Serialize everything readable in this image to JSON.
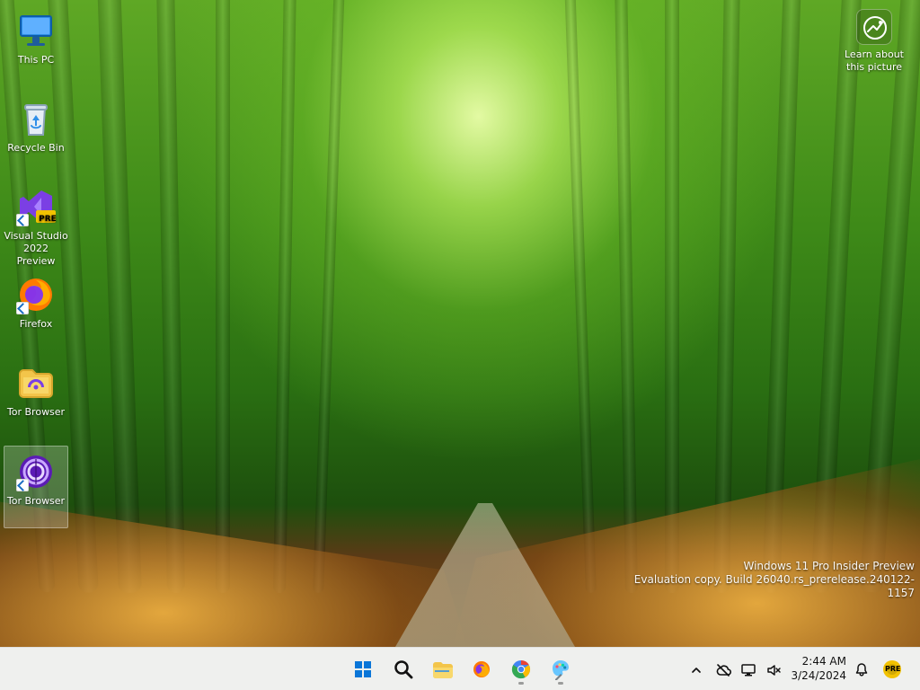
{
  "desktop": {
    "icons": [
      {
        "label": "This PC",
        "icon": "this-pc-icon",
        "shortcut": false,
        "selected": false
      },
      {
        "label": "Recycle Bin",
        "icon": "recycle-bin-icon",
        "shortcut": false,
        "selected": false
      },
      {
        "label": "Visual Studio 2022 Preview",
        "icon": "visual-studio-preview-icon",
        "shortcut": true,
        "selected": false,
        "badge": "PRE"
      },
      {
        "label": "Firefox",
        "icon": "firefox-icon",
        "shortcut": true,
        "selected": false
      },
      {
        "label": "Tor Browser",
        "icon": "tor-browser-folder-icon",
        "shortcut": false,
        "selected": false
      },
      {
        "label": "Tor Browser",
        "icon": "tor-browser-icon",
        "shortcut": true,
        "selected": true
      }
    ],
    "learn_about_picture": {
      "label_line1": "Learn about",
      "label_line2": "this picture",
      "icon": "learn-about-picture-icon"
    },
    "watermark": {
      "line1": "Windows 11 Pro Insider Preview",
      "line2": "Evaluation copy. Build 26040.rs_prerelease.240122-1157"
    }
  },
  "taskbar": {
    "pinned": [
      {
        "name": "start",
        "icon": "windows-start-icon",
        "running": false
      },
      {
        "name": "search",
        "icon": "search-icon",
        "running": false
      },
      {
        "name": "file-explorer",
        "icon": "file-explorer-icon",
        "running": false
      },
      {
        "name": "firefox",
        "icon": "firefox-icon",
        "running": false
      },
      {
        "name": "chrome",
        "icon": "chrome-icon",
        "running": true
      },
      {
        "name": "paint",
        "icon": "paint-icon",
        "running": true
      }
    ],
    "tray": {
      "show_hidden_icon": "chevron-up-icon",
      "icons": [
        "cloud-off-icon",
        "network-icon",
        "volume-muted-icon"
      ],
      "time": "2:44 AM",
      "date": "3/24/2024",
      "notification_icon": "bell-icon",
      "insider_badge": "PRE"
    }
  }
}
